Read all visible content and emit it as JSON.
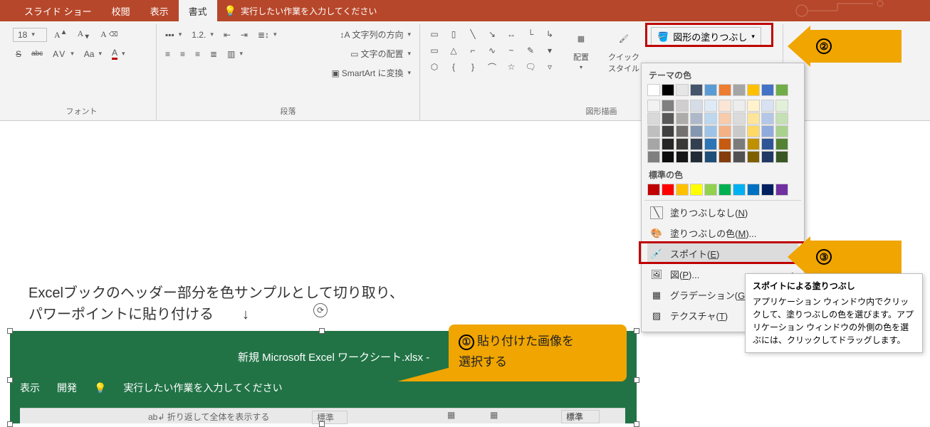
{
  "ribbon": {
    "tabs": [
      "スライド ショー",
      "校閲",
      "表示",
      "書式"
    ],
    "active_tab_index": 3,
    "tell_me_placeholder": "実行したい作業を入力してください"
  },
  "font_group": {
    "size_value": "18",
    "label": "フォント"
  },
  "paragraph_group": {
    "text_direction": "文字列の方向",
    "text_align": "文字の配置",
    "smartart": "SmartArt に変換",
    "label": "段落"
  },
  "drawing_group": {
    "arrange": "配置",
    "quick_styles": "クイック\nスタイル",
    "shape_fill": "図形の塗りつぶし",
    "label": "図形描画"
  },
  "slide_text": {
    "line1": "Excelブックのヘッダー部分を色サンプルとして切り取り、",
    "line2": "パワーポイントに貼り付ける　　↓"
  },
  "excel": {
    "title": "新規 Microsoft Excel ワークシート.xlsx  -",
    "tab_view": "表示",
    "tab_dev": "開発",
    "tell_me": "実行したい作業を入力してください",
    "wrap_text": "折り返して全体を表示する",
    "standard1": "標準",
    "standard2": "標準"
  },
  "callout": {
    "num": "①",
    "text1": "貼り付けた画像を",
    "text2": "選択する"
  },
  "annotations": {
    "n2": "②",
    "n3": "③"
  },
  "popup": {
    "theme_label": "テーマの色",
    "standard_label": "標準の色",
    "no_fill": "塗りつぶしなし(N)",
    "more_colors": "塗りつぶしの色(M)...",
    "eyedropper": "スポイト(E)",
    "picture": "図(P)...",
    "gradient": "グラデーション(G",
    "texture": "テクスチャ(T)",
    "theme_row0": [
      "#ffffff",
      "#000000",
      "#e7e6e6",
      "#44546a",
      "#5b9bd5",
      "#ed7d31",
      "#a5a5a5",
      "#ffc000",
      "#4472c4",
      "#70ad47"
    ],
    "theme_shades": [
      [
        "#f2f2f2",
        "#808080",
        "#d0cece",
        "#d6dce5",
        "#deebf7",
        "#fbe5d6",
        "#ededed",
        "#fff2cc",
        "#d9e2f3",
        "#e2f0d9"
      ],
      [
        "#d9d9d9",
        "#595959",
        "#aeabab",
        "#adb9ca",
        "#bdd7ee",
        "#f7cbac",
        "#dbdbdb",
        "#fee599",
        "#b4c7e7",
        "#c5e0b4"
      ],
      [
        "#bfbfbf",
        "#404040",
        "#757070",
        "#8497b0",
        "#9dc3e6",
        "#f4b183",
        "#c9c9c9",
        "#ffd966",
        "#8faadc",
        "#a9d18e"
      ],
      [
        "#a6a6a6",
        "#262626",
        "#3b3838",
        "#333f50",
        "#2e75b6",
        "#c55a11",
        "#7b7b7b",
        "#bf9000",
        "#2f5597",
        "#548235"
      ],
      [
        "#7f7f7f",
        "#0d0d0d",
        "#171616",
        "#222a35",
        "#1f4e79",
        "#843c0c",
        "#525252",
        "#7f6000",
        "#203864",
        "#385723"
      ]
    ],
    "standard_colors": [
      "#c00000",
      "#ff0000",
      "#ffc000",
      "#ffff00",
      "#92d050",
      "#00b050",
      "#00b0f0",
      "#0070c0",
      "#002060",
      "#7030a0"
    ]
  },
  "tooltip": {
    "title": "スポイトによる塗りつぶし",
    "body": "アプリケーション ウィンドウ内でクリックして、塗りつぶしの色を選びます。アプリケーション ウィンドウの外側の色を選ぶには、クリックしてドラッグします。"
  }
}
